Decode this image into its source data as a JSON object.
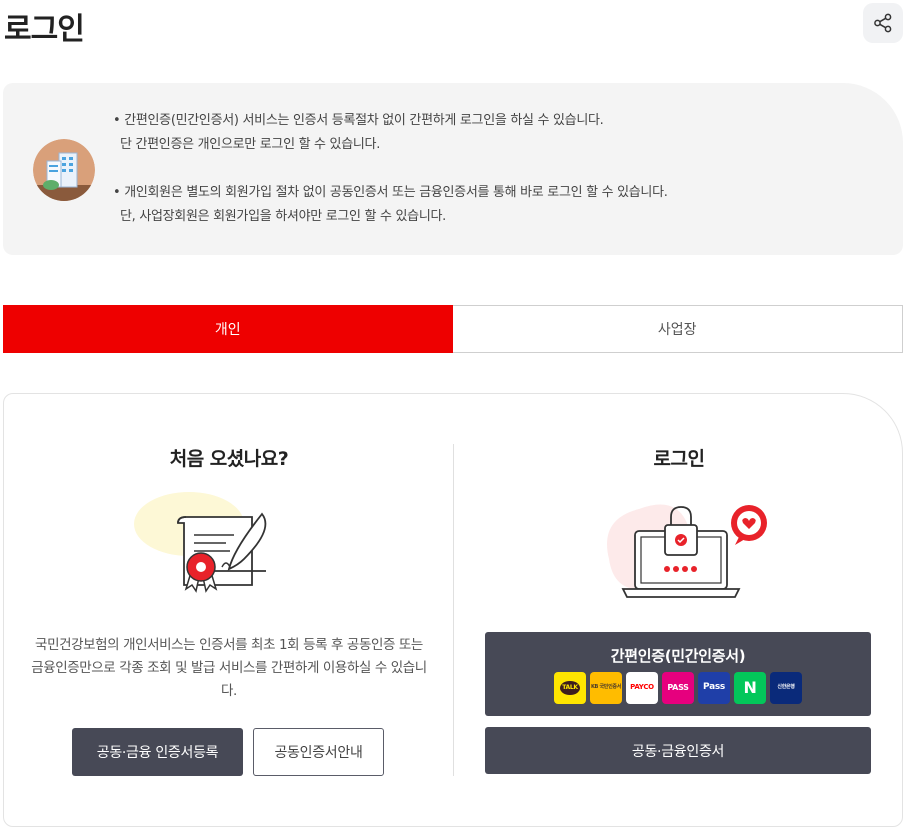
{
  "page": {
    "title": "로그인"
  },
  "notice": {
    "lines": [
      "• 간편인증(민간인증서) 서비스는 인증서 등록절차 없이 간편하게 로그인을 하실 수 있습니다.",
      "  단 간편인증은 개인으로만 로그인 할 수 있습니다.",
      "• 개인회원은 별도의 회원가입 절차 없이 공동인증서 또는 금융인증서를 통해 바로 로그인 할 수 있습니다.",
      "  단, 사업장회원은 회원가입을 하셔야만 로그인 할 수 있습니다."
    ]
  },
  "tabs": [
    {
      "label": "개인",
      "active": true
    },
    {
      "label": "사업장",
      "active": false
    }
  ],
  "left": {
    "title": "처음 오셨나요?",
    "description": "국민건강보험의 개인서비스는 인증서를 최초 1회 등록 후 공동인증 또는 금융인증만으로 각종 조회 및 발급 서비스를 간편하게 이용하실 수 있습니다.",
    "register_button": "공동·금융 인증서등록",
    "guide_button": "공동인증서안내"
  },
  "right": {
    "title": "로그인",
    "simple_auth_button": "간편인증(민간인증서)",
    "cert_button": "공동·금융인증서",
    "providers": [
      {
        "name": "kakao",
        "label": "TALK",
        "bg": "#fee500",
        "fg": "#3c1e1e"
      },
      {
        "name": "kb",
        "label": "KB 국민인증서",
        "bg": "#ffbc00",
        "fg": "#4a3a2a"
      },
      {
        "name": "payco",
        "label": "PAYCO",
        "bg": "#ffffff",
        "fg": "#ff0000"
      },
      {
        "name": "pass-pink",
        "label": "PASS",
        "bg": "#e6007e",
        "fg": "#ffffff"
      },
      {
        "name": "pass-blue",
        "label": "Pass",
        "bg": "#1f3fa8",
        "fg": "#ffffff"
      },
      {
        "name": "naver",
        "label": "N",
        "bg": "#03c75a",
        "fg": "#ffffff"
      },
      {
        "name": "shinhan",
        "label": "신한은행",
        "bg": "#0a2a7a",
        "fg": "#ffffff"
      }
    ]
  },
  "colors": {
    "accent": "#ee0000",
    "dark_button": "#474956"
  },
  "icons": {
    "share": "share-icon"
  }
}
